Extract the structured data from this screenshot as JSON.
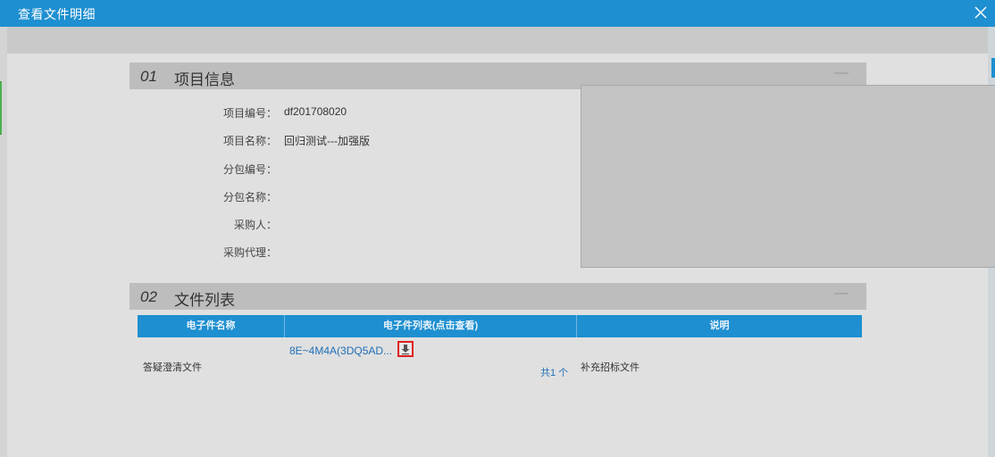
{
  "window": {
    "title": "查看文件明细",
    "close_icon": "close-icon"
  },
  "section1": {
    "number": "01",
    "title": "项目信息",
    "collapse": "—",
    "fields": [
      {
        "label": "项目编号：",
        "value": "df201708020"
      },
      {
        "label": "项目名称：",
        "value": "回归测试---加强版"
      },
      {
        "label": "分包编号：",
        "value": ""
      },
      {
        "label": "分包名称：",
        "value": ""
      },
      {
        "label": "采购人：",
        "value": ""
      },
      {
        "label": "采购代理：",
        "value": ""
      }
    ]
  },
  "section2": {
    "number": "02",
    "title": "文件列表",
    "collapse": "—",
    "columns": [
      "电子件名称",
      "电子件列表(点击查看)",
      "说明"
    ],
    "rows": [
      {
        "name": "答疑澄清文件",
        "file": "8E~4M4A(3DQ5AD...",
        "total": "共1 个",
        "note": "补充招标文件"
      }
    ]
  },
  "colors": {
    "accent": "#1e8fd0",
    "link": "#1f6fb8",
    "highlight": "#e02020"
  }
}
